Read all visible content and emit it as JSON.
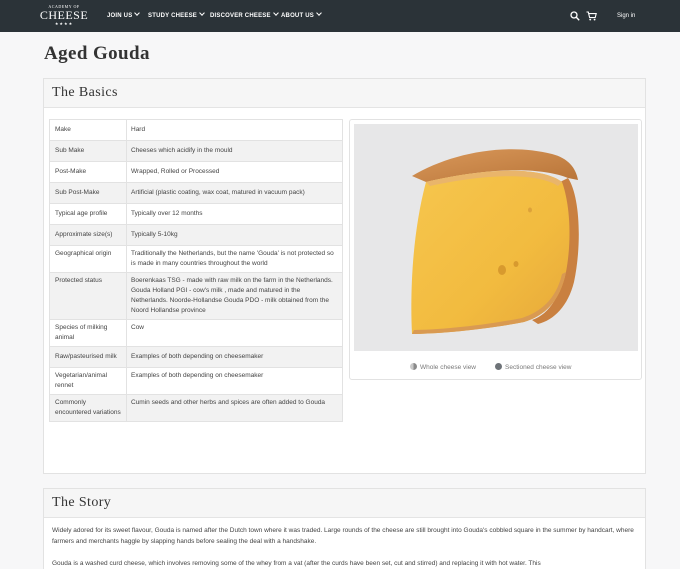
{
  "header": {
    "logo": {
      "small": "ACADEMY OF",
      "big": "CHEESE",
      "stars": "★★★★"
    },
    "nav": [
      {
        "label": "JOIN US"
      },
      {
        "label": "STUDY CHEESE"
      },
      {
        "label": "DISCOVER CHEESE"
      },
      {
        "label": "ABOUT US"
      }
    ],
    "icons": [
      "search-icon",
      "cart-icon"
    ],
    "sign_in": "Sign in",
    "colors": {
      "bar": "#2b3338",
      "text": "#ffffff"
    }
  },
  "page": {
    "title": "Aged Gouda"
  },
  "basics": {
    "heading": "The Basics",
    "rows": [
      {
        "key": "Make",
        "value": "Hard"
      },
      {
        "key": "Sub Make",
        "value": "Cheeses which acidify in the mould"
      },
      {
        "key": "Post-Make",
        "value": "Wrapped, Rolled or Processed"
      },
      {
        "key": "Sub Post-Make",
        "value": "Artificial (plastic coating, wax coat, matured in vacuum pack)"
      },
      {
        "key": "Typical age profile",
        "value": "Typically over 12 months"
      },
      {
        "key": "Approximate size(s)",
        "value": "Typically 5-10kg"
      },
      {
        "key": "Geographical origin",
        "value": "Traditionally the Netherlands, but the name 'Gouda' is not protected so is made in many countries throughout the world"
      },
      {
        "key": "Protected status",
        "value": "Boerenkaas TSG - made with raw milk on the farm in the Netherlands. Gouda Holland PGI - cow's milk , made and matured in the Netherlands. Noorde-Hollandse Gouda PDO - milk obtained from the Noord Hollandse province"
      },
      {
        "key": "Species of milking animal",
        "value": "Cow"
      },
      {
        "key": "Raw/pasteurised milk",
        "value": "Examples of both depending on cheesemaker"
      },
      {
        "key": "Vegetarian/animal rennet",
        "value": "Examples of both depending on cheesemaker"
      },
      {
        "key": "Commonly encountered variations",
        "value": "Cumin seeds and other herbs and spices are often added to Gouda"
      }
    ],
    "image_views": [
      {
        "label": "Whole cheese view",
        "icon": "half-circle-icon"
      },
      {
        "label": "Sectioned cheese view",
        "icon": "filled-circle-icon"
      }
    ]
  },
  "story": {
    "heading": "The Story",
    "paragraphs": [
      "Widely adored for its sweet flavour, Gouda is named after the Dutch town where it was traded. Large rounds of the cheese are still brought into Gouda's cobbled square in the summer by handcart, where farmers and merchants haggle by slapping hands before sealing the deal with a handshake.",
      "Gouda is a washed curd cheese, which involves removing some of the whey from a vat (after the curds have been set, cut and stirred) and replacing it with hot water. This"
    ]
  }
}
